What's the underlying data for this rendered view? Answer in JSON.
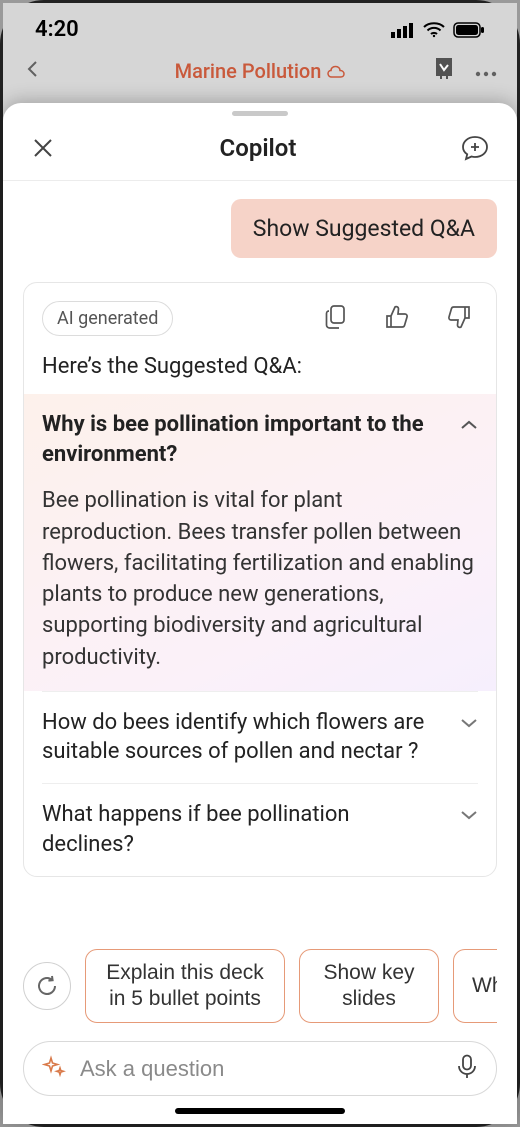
{
  "status": {
    "time": "4:20"
  },
  "background": {
    "title": "Marine Pollution"
  },
  "sheet": {
    "title": "Copilot"
  },
  "chat": {
    "user_message": "Show Suggested Q&A",
    "bot": {
      "chip": "AI generated",
      "intro": "Here’s the Suggested Q&A:",
      "qa": [
        {
          "q": "Why is bee pollination important to the environment?",
          "a": "Bee pollination is vital for plant reproduction. Bees transfer pollen between flowers, facilitating fertilization and enabling plants to produce new generations, supporting biodiversity and agricultural productivity.",
          "expanded": true
        },
        {
          "q": "How do bees identify which flowers are suitable sources of pollen and nectar ?",
          "expanded": false
        },
        {
          "q": "What happens if bee pollination declines?",
          "expanded": false
        }
      ]
    }
  },
  "suggestions": [
    "Explain this deck in 5 bullet points",
    "Show key slides",
    "Which mari"
  ],
  "input": {
    "placeholder": "Ask a question"
  }
}
